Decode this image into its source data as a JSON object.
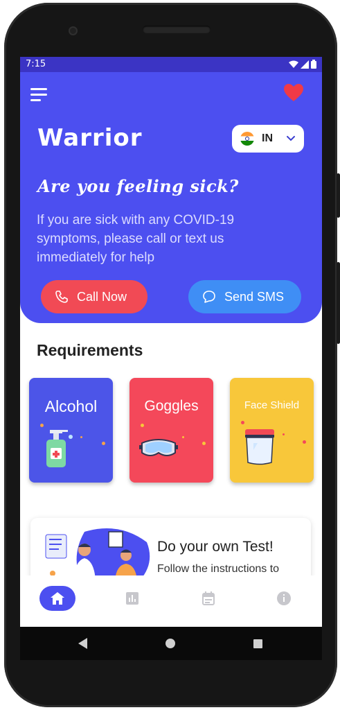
{
  "status_bar": {
    "time": "7:15"
  },
  "header": {
    "app_title": "Warrior",
    "country_code": "IN"
  },
  "hero": {
    "question": "Are you feeling sick?",
    "message": "If you are sick with any COVID-19 symptoms, please call or text us immediately for help",
    "call_label": "Call Now",
    "sms_label": "Send SMS"
  },
  "requirements": {
    "title": "Requirements",
    "items": [
      {
        "label": "Alcohol",
        "color": "#4c55e8"
      },
      {
        "label": "Goggles",
        "color": "#f4485a"
      },
      {
        "label": "Face Shield",
        "color": "#f8c73a"
      }
    ]
  },
  "test_card": {
    "title": "Do your own Test!",
    "subtitle": "Follow the instructions to"
  },
  "bottom_nav": [
    "home-icon",
    "stats-icon",
    "calendar-icon",
    "info-icon"
  ],
  "colors": {
    "primary": "#4c4ff0",
    "call": "#f14a55",
    "sms": "#3f8ef5"
  }
}
